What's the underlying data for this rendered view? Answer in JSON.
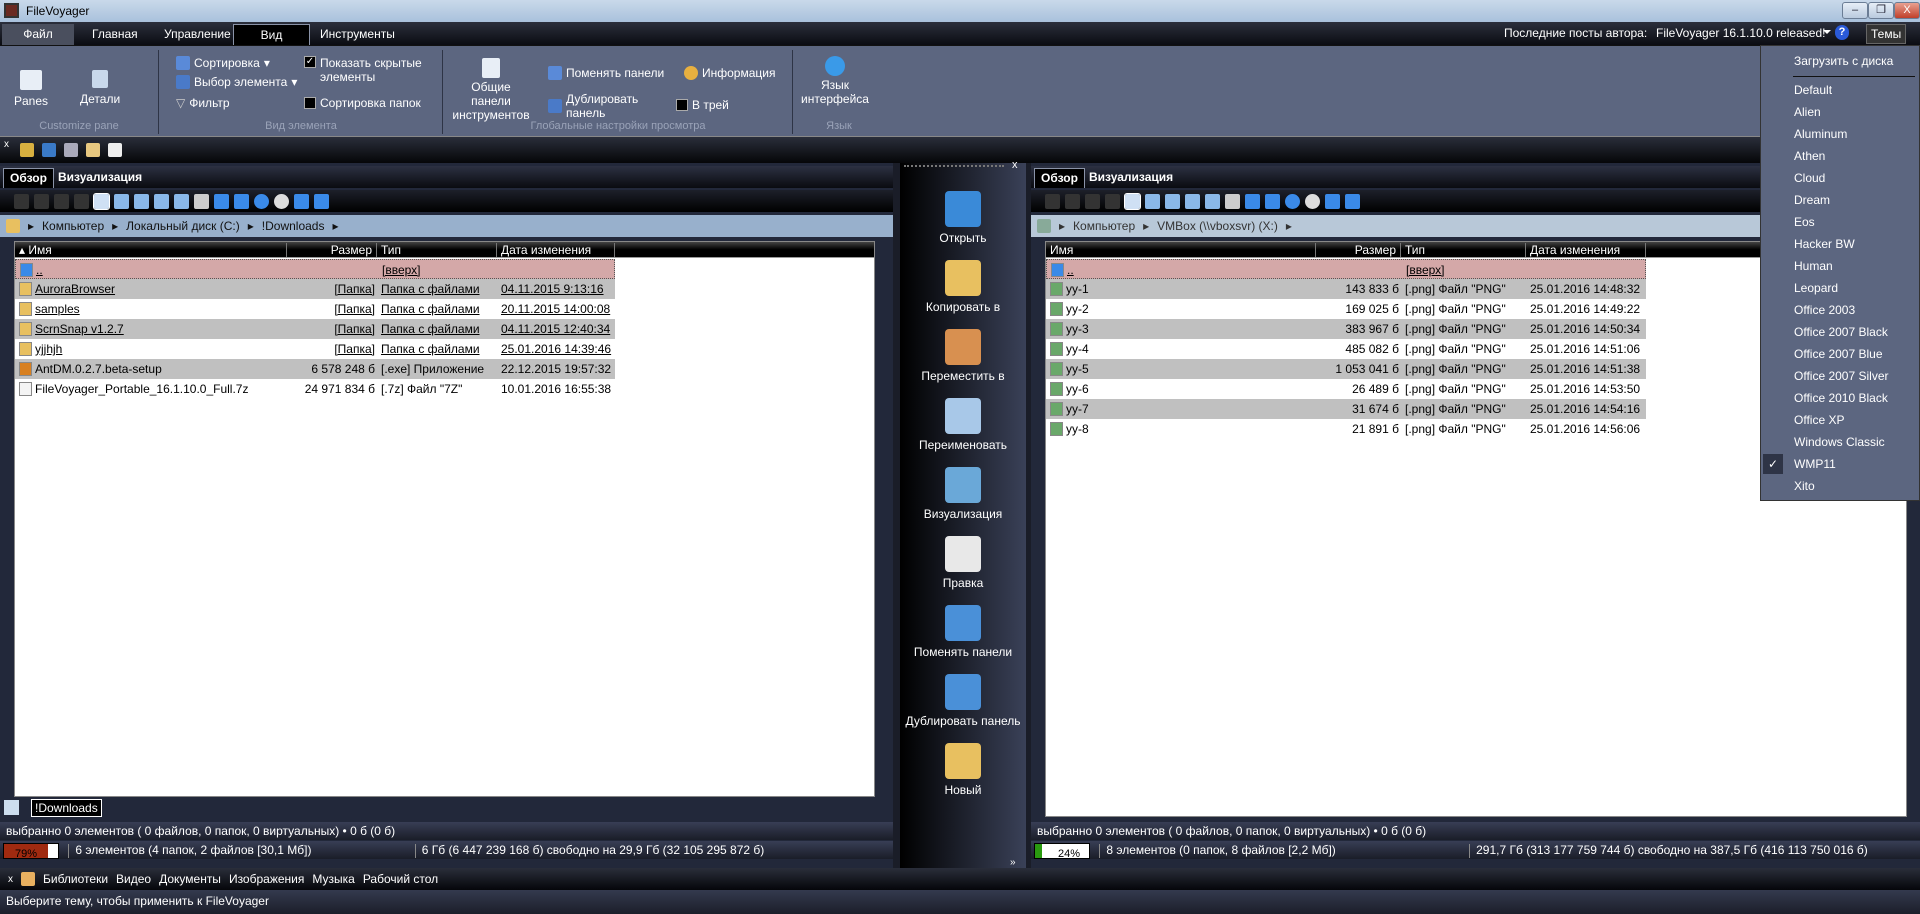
{
  "window": {
    "title": "FileVoyager",
    "minimize": "–",
    "restore": "❐",
    "close": "X"
  },
  "ribbon_tabs": [
    "Файл",
    "Главная",
    "Управление",
    "Вид",
    "Инструменты"
  ],
  "active_ribbon_tab": "Вид",
  "header_right": {
    "posts_label": "Последние посты автора:",
    "post_link": "FileVoyager 16.1.10.0 released!",
    "help": "?",
    "themes_button": "Темы"
  },
  "ribbon": {
    "customize_pane": {
      "label": "Customize pane",
      "panes": "Panes",
      "details": "Детали"
    },
    "item_view": {
      "label": "Вид элемента",
      "sort": "Сортировка",
      "select": "Выбор элемента",
      "filter": "Фильтр",
      "show_hidden": "Показать скрытые элементы",
      "show_hidden_checked": true,
      "sort_folders": "Сортировка папок",
      "sort_folders_checked": false
    },
    "global": {
      "label": "Глобальные настройки просмотра",
      "common_toolbars": "Общие панели инструментов",
      "swap": "Поменять панели",
      "duplicate": "Дублировать панель",
      "info": "Информация",
      "tray": "В трей",
      "tray_checked": false
    },
    "language": {
      "label": "Язык",
      "button": "Язык интерфейса"
    }
  },
  "left_pane": {
    "tabs": [
      "Обзор",
      "Визуализация"
    ],
    "breadcrumb": [
      "Компьютер",
      "Локальный диск (C:)",
      "!Downloads"
    ],
    "columns": [
      "Имя",
      "Размер",
      "Тип",
      "Дата изменения"
    ],
    "rows": [
      {
        "name": "..",
        "size": "",
        "type": "[вверх]",
        "date": "",
        "kind": "up"
      },
      {
        "name": "AuroraBrowser",
        "size": "[Папка]",
        "type": "Папка с файлами",
        "date": "04.11.2015 9:13:16",
        "kind": "folder"
      },
      {
        "name": "samples",
        "size": "[Папка]",
        "type": "Папка с файлами",
        "date": "20.11.2015 14:00:08",
        "kind": "folder"
      },
      {
        "name": "ScrnSnap v1.2.7",
        "size": "[Папка]",
        "type": "Папка с файлами",
        "date": "04.11.2015 12:40:34",
        "kind": "folder"
      },
      {
        "name": "yjjhjh",
        "size": "[Папка]",
        "type": "Папка с файлами",
        "date": "25.01.2016 14:39:46",
        "kind": "folder"
      },
      {
        "name": "AntDM.0.2.7.beta-setup",
        "size": "6 578 248 б",
        "type": "[.exe]  Приложение",
        "date": "22.12.2015 19:57:32",
        "kind": "exe"
      },
      {
        "name": "FileVoyager_Portable_16.1.10.0_Full.7z",
        "size": "24 971 834 б",
        "type": "[.7z]  Файл \"7Z\"",
        "date": "10.01.2016 16:55:38",
        "kind": "file"
      }
    ],
    "bottom_tab": "!Downloads",
    "status_selected": "выбранно 0 элементов ( 0 файлов, 0 папок, 0 виртуальных) • 0 б (0 б)",
    "disk_usage_percent": 79,
    "disk_usage_label": "79%",
    "disk_color": "#a02a10",
    "status_items": "6 элементов (4 папок, 2 файлов [30,1 Мб])",
    "status_free": "6 Гб (6 447 239 168 б) свободно на 29,9 Гб (32 105 295 872 б)"
  },
  "right_pane": {
    "tabs": [
      "Обзор",
      "Визуализация"
    ],
    "breadcrumb": [
      "Компьютер",
      "VMBox (\\\\vboxsvr) (X:)"
    ],
    "columns": [
      "Имя",
      "Размер",
      "Тип",
      "Дата изменения"
    ],
    "rows": [
      {
        "name": "..",
        "size": "",
        "type": "[вверх]",
        "date": "",
        "kind": "up"
      },
      {
        "name": "yy-1",
        "size": "143 833 б",
        "type": "[.png]  Файл \"PNG\"",
        "date": "25.01.2016 14:48:32",
        "kind": "png"
      },
      {
        "name": "yy-2",
        "size": "169 025 б",
        "type": "[.png]  Файл \"PNG\"",
        "date": "25.01.2016 14:49:22",
        "kind": "png"
      },
      {
        "name": "yy-3",
        "size": "383 967 б",
        "type": "[.png]  Файл \"PNG\"",
        "date": "25.01.2016 14:50:34",
        "kind": "png"
      },
      {
        "name": "yy-4",
        "size": "485 082 б",
        "type": "[.png]  Файл \"PNG\"",
        "date": "25.01.2016 14:51:06",
        "kind": "png"
      },
      {
        "name": "yy-5",
        "size": "1 053 041 б",
        "type": "[.png]  Файл \"PNG\"",
        "date": "25.01.2016 14:51:38",
        "kind": "png"
      },
      {
        "name": "yy-6",
        "size": "26 489 б",
        "type": "[.png]  Файл \"PNG\"",
        "date": "25.01.2016 14:53:50",
        "kind": "png"
      },
      {
        "name": "yy-7",
        "size": "31 674 б",
        "type": "[.png]  Файл \"PNG\"",
        "date": "25.01.2016 14:54:16",
        "kind": "png"
      },
      {
        "name": "yy-8",
        "size": "21 891 б",
        "type": "[.png]  Файл \"PNG\"",
        "date": "25.01.2016 14:56:06",
        "kind": "png"
      }
    ],
    "status_selected": "выбранно 0 элементов ( 0 файлов, 0 папок, 0 виртуальных) • 0 б (0 б)",
    "disk_usage_percent": 24,
    "disk_usage_label": "24%",
    "disk_color": "#2a9a10",
    "status_items": "8 элементов (0 папок, 8 файлов [2,2 Мб])",
    "status_free": "291,7 Гб (313 177 759 744 б) свободно на 387,5 Гб (416 113 750 016 б)"
  },
  "middle_actions": [
    {
      "label": "Открыть",
      "icon": "gears-icon",
      "color": "#3a8ad8"
    },
    {
      "label": "Копировать в",
      "icon": "copy-to-icon",
      "color": "#e8c060"
    },
    {
      "label": "Переместить в",
      "icon": "move-to-icon",
      "color": "#d89050"
    },
    {
      "label": "Переименовать",
      "icon": "rename-icon",
      "color": "#a8c8e8"
    },
    {
      "label": "Визуализация",
      "icon": "visualize-icon",
      "color": "#6aa8d8"
    },
    {
      "label": "Правка",
      "icon": "edit-icon",
      "color": "#e8e8e8"
    },
    {
      "label": "Поменять панели",
      "icon": "swap-panels-icon",
      "color": "#4a90d8"
    },
    {
      "label": "Дублировать панель",
      "icon": "duplicate-panel-icon",
      "color": "#4a90d8"
    },
    {
      "label": "Новый",
      "icon": "new-folder-icon",
      "color": "#e8c060"
    }
  ],
  "themes_menu": {
    "load": "Загрузить с диска",
    "items": [
      "Default",
      "Alien",
      "Aluminum",
      "Athen",
      "Cloud",
      "Dream",
      "Eos",
      "Hacker BW",
      "Human",
      "Leopard",
      "Office 2003",
      "Office 2007 Black",
      "Office 2007 Blue",
      "Office 2007 Silver",
      "Office 2010 Black",
      "Office XP",
      "Windows Classic",
      "WMP11",
      "Xito"
    ],
    "checked": "WMP11"
  },
  "libraries": [
    "Библиотеки",
    "Видео",
    "Документы",
    "Изображения",
    "Музыка",
    "Рабочий стол"
  ],
  "status_message": "Выберите тему, чтобы применить к FileVoyager"
}
